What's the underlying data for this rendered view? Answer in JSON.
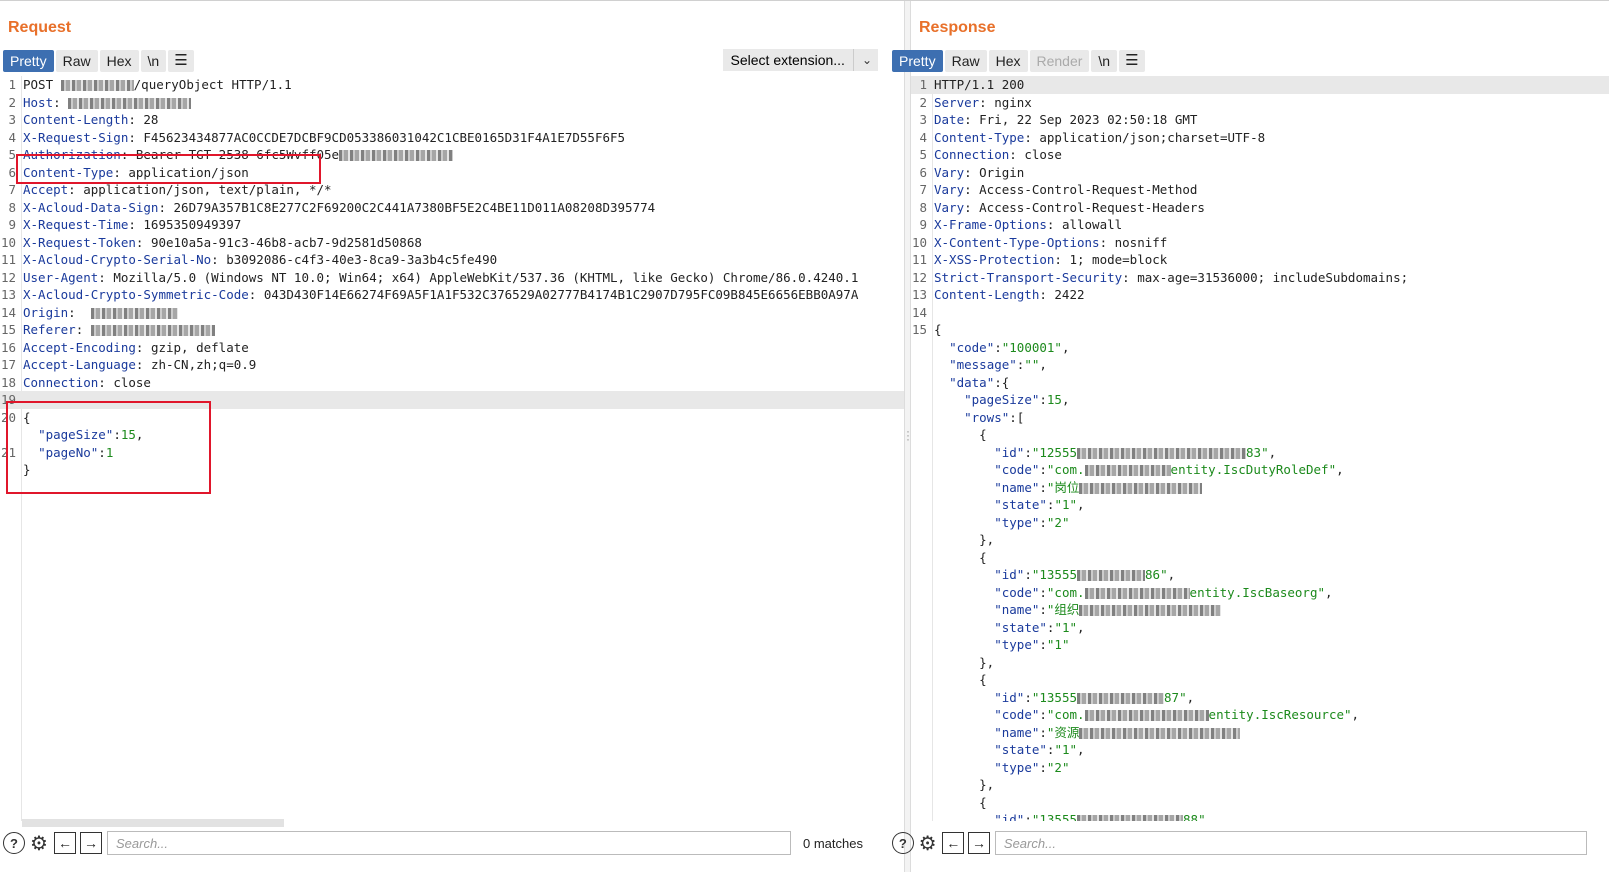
{
  "request": {
    "title": "Request",
    "tabs": [
      "Pretty",
      "Raw",
      "Hex",
      "\\n"
    ],
    "extension_select": "Select extension...",
    "lines": [
      {
        "n": "1",
        "parts": [
          [
            "hv",
            "POST "
          ],
          [
            "blur",
            ""
          ],
          [
            "hv",
            "/queryObject HTTP/1.1"
          ]
        ]
      },
      {
        "n": "2",
        "parts": [
          [
            "hn",
            "Host"
          ],
          [
            "hv",
            ": "
          ],
          [
            "blur",
            ""
          ]
        ]
      },
      {
        "n": "3",
        "parts": [
          [
            "hn",
            "Content-Length"
          ],
          [
            "hv",
            ": 28"
          ]
        ]
      },
      {
        "n": "4",
        "parts": [
          [
            "hn",
            "X-Request-Sign"
          ],
          [
            "hv",
            ": F45623434877AC0CCDE7DCBF9CD053386031042C1CBE0165D31F4A1E7D55F6F5"
          ]
        ]
      },
      {
        "n": "5",
        "parts": [
          [
            "hn",
            "Authorization"
          ],
          [
            "hv",
            ": Bearer TGT-2538-6fc5Wvff05e"
          ],
          [
            "blur",
            ""
          ]
        ]
      },
      {
        "n": "6",
        "parts": [
          [
            "hn",
            "Content-Type"
          ],
          [
            "hv",
            ": application/json"
          ]
        ]
      },
      {
        "n": "7",
        "parts": [
          [
            "hn",
            "Accept"
          ],
          [
            "hv",
            ": application/json, text/plain, */*"
          ]
        ]
      },
      {
        "n": "8",
        "parts": [
          [
            "hn",
            "X-Acloud-Data-Sign"
          ],
          [
            "hv",
            ": 26D79A357B1C8E277C2F69200C2C441A7380BF5E2C4BE11D011A08208D395774"
          ]
        ]
      },
      {
        "n": "9",
        "parts": [
          [
            "hn",
            "X-Request-Time"
          ],
          [
            "hv",
            ": 1695350949397"
          ]
        ]
      },
      {
        "n": "10",
        "parts": [
          [
            "hn",
            "X-Request-Token"
          ],
          [
            "hv",
            ": 90e10a5a-91c3-46b8-acb7-9d2581d50868"
          ]
        ]
      },
      {
        "n": "11",
        "parts": [
          [
            "hn",
            "X-Acloud-Crypto-Serial-No"
          ],
          [
            "hv",
            ": b3092086-c4f3-40e3-8ca9-3a3b4c5fe490"
          ]
        ]
      },
      {
        "n": "12",
        "parts": [
          [
            "hn",
            "User-Agent"
          ],
          [
            "hv",
            ": Mozilla/5.0 (Windows NT 10.0; Win64; x64) AppleWebKit/537.36 (KHTML, like Gecko) Chrome/86.0.4240.1"
          ]
        ]
      },
      {
        "n": "13",
        "parts": [
          [
            "hn",
            "X-Acloud-Crypto-Symmetric-Code"
          ],
          [
            "hv",
            ": 043D430F14E66274F69A5F1A1F532C376529A02777B4174B1C2907D795FC09B845E6656EBB0A97A"
          ]
        ]
      },
      {
        "n": "14",
        "parts": [
          [
            "hn",
            "Origin"
          ],
          [
            "hv",
            ":  "
          ],
          [
            "blur",
            ""
          ]
        ]
      },
      {
        "n": "15",
        "parts": [
          [
            "hn",
            "Referer"
          ],
          [
            "hv",
            ": "
          ],
          [
            "blur",
            ""
          ]
        ]
      },
      {
        "n": "16",
        "parts": [
          [
            "hn",
            "Accept-Encoding"
          ],
          [
            "hv",
            ": gzip, deflate"
          ]
        ]
      },
      {
        "n": "17",
        "parts": [
          [
            "hn",
            "Accept-Language"
          ],
          [
            "hv",
            ": zh-CN,zh;q=0.9"
          ]
        ]
      },
      {
        "n": "18",
        "parts": [
          [
            "hn",
            "Connection"
          ],
          [
            "hv",
            ": close"
          ]
        ]
      },
      {
        "n": "19",
        "parts": [],
        "hl": true
      },
      {
        "n": "20",
        "parts": [
          [
            "hv",
            "{"
          ]
        ]
      },
      {
        "n": "",
        "parts": [
          [
            "hv",
            "  "
          ],
          [
            "jk",
            "\"pageSize\""
          ],
          [
            "hv",
            ":"
          ],
          [
            "jn",
            "15"
          ],
          [
            "hv",
            ","
          ]
        ]
      },
      {
        "n": "21",
        "parts": [
          [
            "hv",
            "  "
          ],
          [
            "jk",
            "\"pageNo\""
          ],
          [
            "hv",
            ":"
          ],
          [
            "jn",
            "1"
          ]
        ]
      },
      {
        "n": "",
        "parts": [
          [
            "hv",
            "}"
          ]
        ]
      }
    ],
    "search_placeholder": "Search...",
    "matches": "0 matches"
  },
  "response": {
    "title": "Response",
    "tabs": [
      "Pretty",
      "Raw",
      "Hex",
      "Render",
      "\\n"
    ],
    "lines": [
      {
        "n": "1",
        "parts": [
          [
            "hv",
            "HTTP/1.1 200"
          ]
        ],
        "hl": true
      },
      {
        "n": "2",
        "parts": [
          [
            "hn",
            "Server"
          ],
          [
            "hv",
            ": nginx"
          ]
        ]
      },
      {
        "n": "3",
        "parts": [
          [
            "hn",
            "Date"
          ],
          [
            "hv",
            ": Fri, 22 Sep 2023 02:50:18 GMT"
          ]
        ]
      },
      {
        "n": "4",
        "parts": [
          [
            "hn",
            "Content-Type"
          ],
          [
            "hv",
            ": application/json;charset=UTF-8"
          ]
        ]
      },
      {
        "n": "5",
        "parts": [
          [
            "hn",
            "Connection"
          ],
          [
            "hv",
            ": close"
          ]
        ]
      },
      {
        "n": "6",
        "parts": [
          [
            "hn",
            "Vary"
          ],
          [
            "hv",
            ": Origin"
          ]
        ]
      },
      {
        "n": "7",
        "parts": [
          [
            "hn",
            "Vary"
          ],
          [
            "hv",
            ": Access-Control-Request-Method"
          ]
        ]
      },
      {
        "n": "8",
        "parts": [
          [
            "hn",
            "Vary"
          ],
          [
            "hv",
            ": Access-Control-Request-Headers"
          ]
        ]
      },
      {
        "n": "9",
        "parts": [
          [
            "hn",
            "X-Frame-Options"
          ],
          [
            "hv",
            ": allowall"
          ]
        ]
      },
      {
        "n": "10",
        "parts": [
          [
            "hn",
            "X-Content-Type-Options"
          ],
          [
            "hv",
            ": nosniff"
          ]
        ]
      },
      {
        "n": "11",
        "parts": [
          [
            "hn",
            "X-XSS-Protection"
          ],
          [
            "hv",
            ": 1; mode=block"
          ]
        ]
      },
      {
        "n": "12",
        "parts": [
          [
            "hn",
            "Strict-Transport-Security"
          ],
          [
            "hv",
            ": max-age=31536000; includeSubdomains;"
          ]
        ]
      },
      {
        "n": "13",
        "parts": [
          [
            "hn",
            "Content-Length"
          ],
          [
            "hv",
            ": 2422"
          ]
        ]
      },
      {
        "n": "14",
        "parts": []
      },
      {
        "n": "15",
        "parts": [
          [
            "hv",
            "{"
          ]
        ]
      },
      {
        "n": "",
        "parts": [
          [
            "hv",
            "  "
          ],
          [
            "jk",
            "\"code\""
          ],
          [
            "hv",
            ":"
          ],
          [
            "js",
            "\"100001\""
          ],
          [
            "hv",
            ","
          ]
        ]
      },
      {
        "n": "",
        "parts": [
          [
            "hv",
            "  "
          ],
          [
            "jk",
            "\"message\""
          ],
          [
            "hv",
            ":"
          ],
          [
            "js",
            "\"\""
          ],
          [
            "hv",
            ","
          ]
        ]
      },
      {
        "n": "",
        "parts": [
          [
            "hv",
            "  "
          ],
          [
            "jk",
            "\"data\""
          ],
          [
            "hv",
            ":{"
          ]
        ]
      },
      {
        "n": "",
        "parts": [
          [
            "hv",
            "    "
          ],
          [
            "jk",
            "\"pageSize\""
          ],
          [
            "hv",
            ":"
          ],
          [
            "jn",
            "15"
          ],
          [
            "hv",
            ","
          ]
        ]
      },
      {
        "n": "",
        "parts": [
          [
            "hv",
            "    "
          ],
          [
            "jk",
            "\"rows\""
          ],
          [
            "hv",
            ":["
          ]
        ]
      },
      {
        "n": "",
        "parts": [
          [
            "hv",
            "      {"
          ]
        ]
      },
      {
        "n": "",
        "parts": [
          [
            "hv",
            "        "
          ],
          [
            "jk",
            "\"id\""
          ],
          [
            "hv",
            ":"
          ],
          [
            "js",
            "\"12555"
          ],
          [
            "blur",
            ""
          ],
          [
            "js",
            "83\""
          ],
          [
            "hv",
            ","
          ]
        ]
      },
      {
        "n": "",
        "parts": [
          [
            "hv",
            "        "
          ],
          [
            "jk",
            "\"code\""
          ],
          [
            "hv",
            ":"
          ],
          [
            "js",
            "\"com."
          ],
          [
            "blur",
            ""
          ],
          [
            "js",
            "entity.IscDutyRoleDef\""
          ],
          [
            "hv",
            ","
          ]
        ]
      },
      {
        "n": "",
        "parts": [
          [
            "hv",
            "        "
          ],
          [
            "jk",
            "\"name\""
          ],
          [
            "hv",
            ":"
          ],
          [
            "js",
            "\"岗位"
          ],
          [
            "blur",
            ""
          ]
        ]
      },
      {
        "n": "",
        "parts": [
          [
            "hv",
            "        "
          ],
          [
            "jk",
            "\"state\""
          ],
          [
            "hv",
            ":"
          ],
          [
            "js",
            "\"1\""
          ],
          [
            "hv",
            ","
          ]
        ]
      },
      {
        "n": "",
        "parts": [
          [
            "hv",
            "        "
          ],
          [
            "jk",
            "\"type\""
          ],
          [
            "hv",
            ":"
          ],
          [
            "js",
            "\"2\""
          ]
        ]
      },
      {
        "n": "",
        "parts": [
          [
            "hv",
            "      },"
          ]
        ]
      },
      {
        "n": "",
        "parts": [
          [
            "hv",
            "      {"
          ]
        ]
      },
      {
        "n": "",
        "parts": [
          [
            "hv",
            "        "
          ],
          [
            "jk",
            "\"id\""
          ],
          [
            "hv",
            ":"
          ],
          [
            "js",
            "\"13555"
          ],
          [
            "blur",
            ""
          ],
          [
            "js",
            "86\""
          ],
          [
            "hv",
            ","
          ]
        ]
      },
      {
        "n": "",
        "parts": [
          [
            "hv",
            "        "
          ],
          [
            "jk",
            "\"code\""
          ],
          [
            "hv",
            ":"
          ],
          [
            "js",
            "\"com."
          ],
          [
            "blur",
            ""
          ],
          [
            "js",
            "entity.IscBaseorg\""
          ],
          [
            "hv",
            ","
          ]
        ]
      },
      {
        "n": "",
        "parts": [
          [
            "hv",
            "        "
          ],
          [
            "jk",
            "\"name\""
          ],
          [
            "hv",
            ":"
          ],
          [
            "js",
            "\"组织"
          ],
          [
            "blur",
            ""
          ]
        ]
      },
      {
        "n": "",
        "parts": [
          [
            "hv",
            "        "
          ],
          [
            "jk",
            "\"state\""
          ],
          [
            "hv",
            ":"
          ],
          [
            "js",
            "\"1\""
          ],
          [
            "hv",
            ","
          ]
        ]
      },
      {
        "n": "",
        "parts": [
          [
            "hv",
            "        "
          ],
          [
            "jk",
            "\"type\""
          ],
          [
            "hv",
            ":"
          ],
          [
            "js",
            "\"1\""
          ]
        ]
      },
      {
        "n": "",
        "parts": [
          [
            "hv",
            "      },"
          ]
        ]
      },
      {
        "n": "",
        "parts": [
          [
            "hv",
            "      {"
          ]
        ]
      },
      {
        "n": "",
        "parts": [
          [
            "hv",
            "        "
          ],
          [
            "jk",
            "\"id\""
          ],
          [
            "hv",
            ":"
          ],
          [
            "js",
            "\"13555"
          ],
          [
            "blur",
            ""
          ],
          [
            "js",
            "87\""
          ],
          [
            "hv",
            ","
          ]
        ]
      },
      {
        "n": "",
        "parts": [
          [
            "hv",
            "        "
          ],
          [
            "jk",
            "\"code\""
          ],
          [
            "hv",
            ":"
          ],
          [
            "js",
            "\"com."
          ],
          [
            "blur",
            ""
          ],
          [
            "js",
            "entity.IscResource\""
          ],
          [
            "hv",
            ","
          ]
        ]
      },
      {
        "n": "",
        "parts": [
          [
            "hv",
            "        "
          ],
          [
            "jk",
            "\"name\""
          ],
          [
            "hv",
            ":"
          ],
          [
            "js",
            "\"资源"
          ],
          [
            "blur",
            ""
          ]
        ]
      },
      {
        "n": "",
        "parts": [
          [
            "hv",
            "        "
          ],
          [
            "jk",
            "\"state\""
          ],
          [
            "hv",
            ":"
          ],
          [
            "js",
            "\"1\""
          ],
          [
            "hv",
            ","
          ]
        ]
      },
      {
        "n": "",
        "parts": [
          [
            "hv",
            "        "
          ],
          [
            "jk",
            "\"type\""
          ],
          [
            "hv",
            ":"
          ],
          [
            "js",
            "\"2\""
          ]
        ]
      },
      {
        "n": "",
        "parts": [
          [
            "hv",
            "      },"
          ]
        ]
      },
      {
        "n": "",
        "parts": [
          [
            "hv",
            "      {"
          ]
        ]
      },
      {
        "n": "",
        "parts": [
          [
            "hv",
            "        "
          ],
          [
            "jk",
            "\"id\""
          ],
          [
            "hv",
            ":"
          ],
          [
            "js",
            "\"13555"
          ],
          [
            "blur",
            ""
          ],
          [
            "js",
            "88\""
          ],
          [
            "hv",
            ","
          ]
        ]
      }
    ],
    "search_placeholder": "Search..."
  },
  "icons": {
    "help": "help-icon",
    "settings": "gear-icon",
    "prev": "arrow-left-icon",
    "next": "arrow-right-icon",
    "menu": "menu-icon"
  },
  "colors": {
    "accent": "#e8702a",
    "active_tab": "#3d6fb1",
    "highlight_box": "#e0162b"
  }
}
